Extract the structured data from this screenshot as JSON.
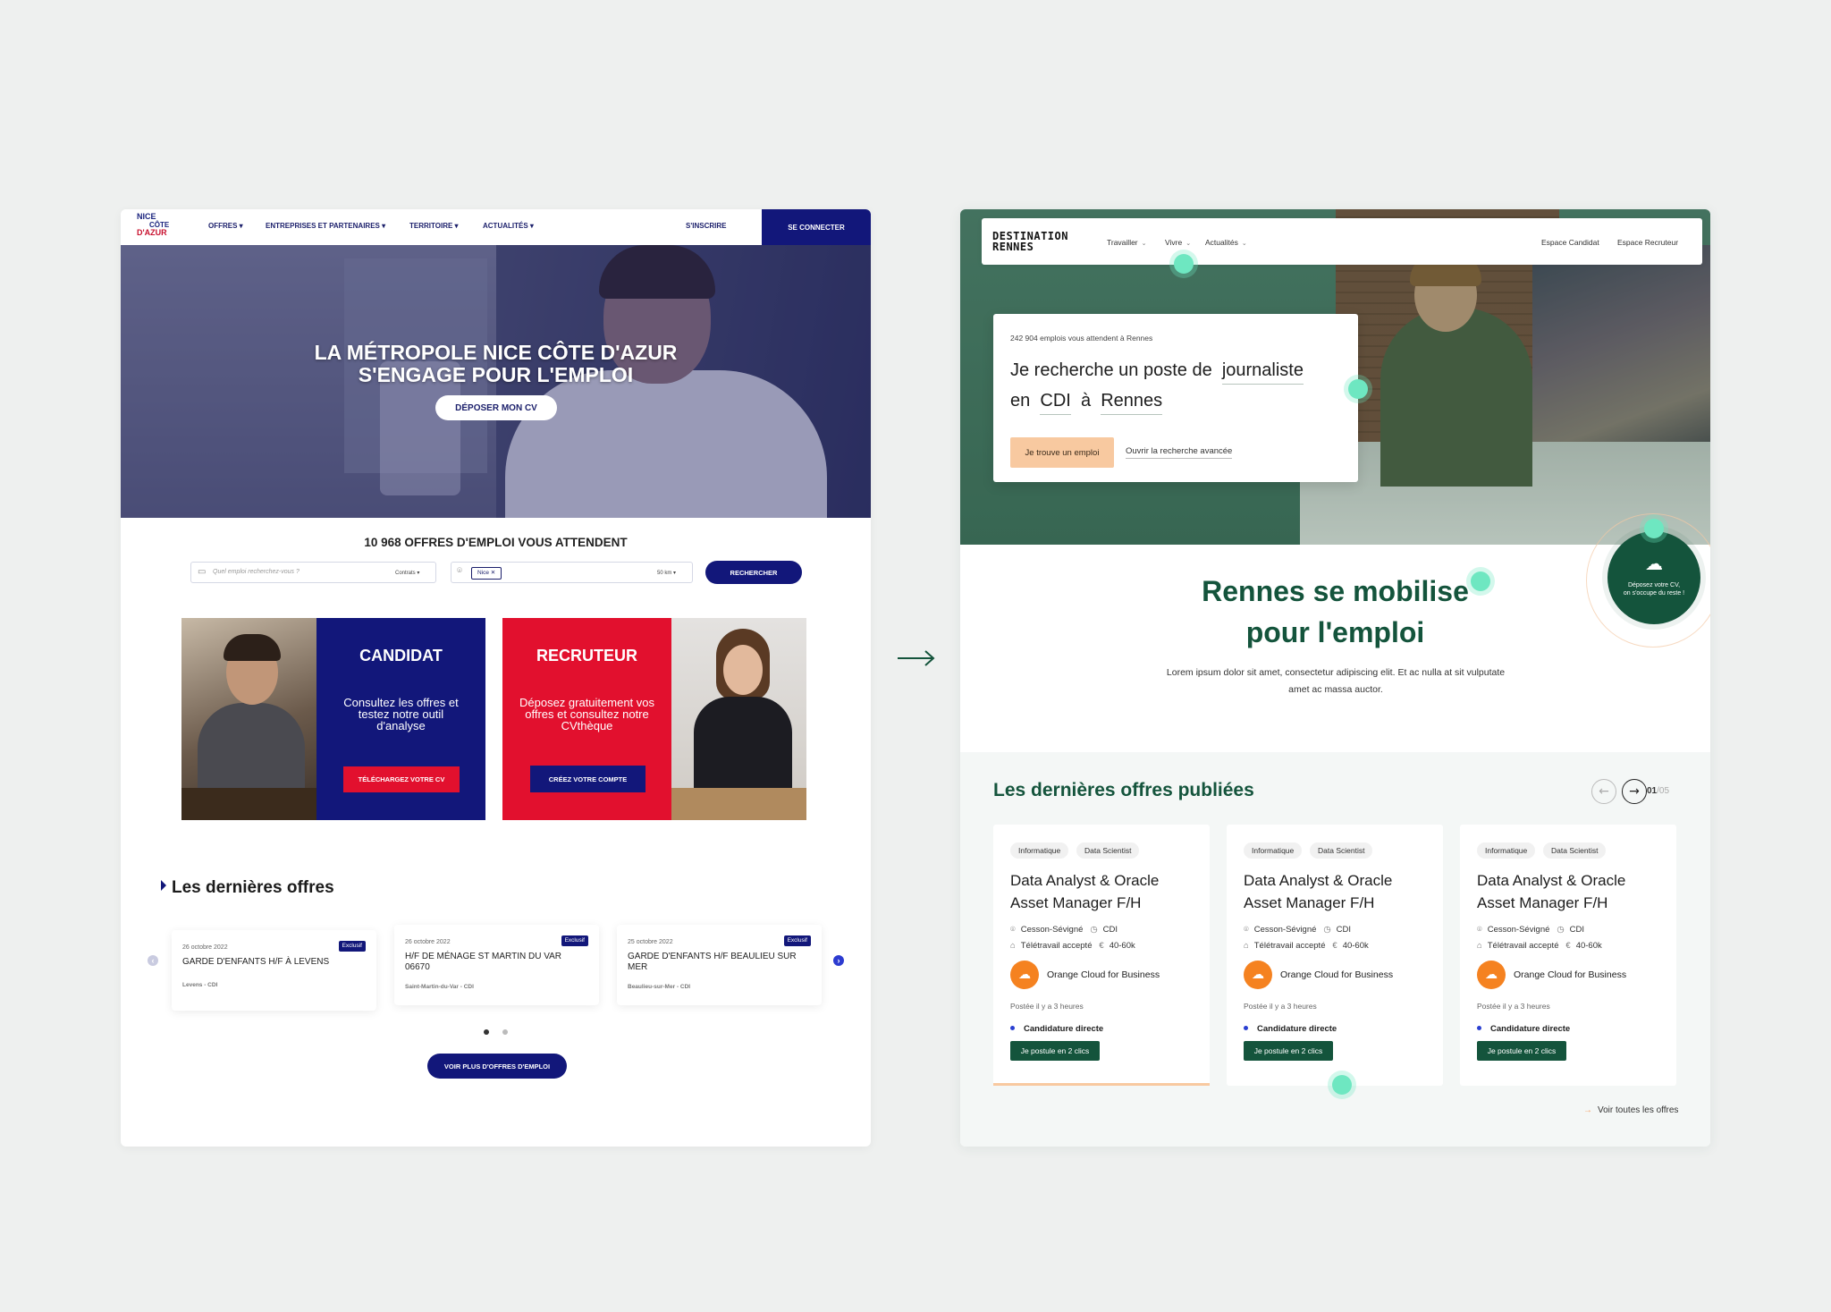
{
  "left": {
    "logo": [
      "NICE",
      "CÔTE",
      "D'AZUR"
    ],
    "nav": {
      "items": [
        "OFFRES ▾",
        "ENTREPRISES ET PARTENAIRES ▾",
        "TERRITOIRE ▾",
        "ACTUALITÉS ▾"
      ],
      "signup": "S'INSCRIRE",
      "login": "SE CONNECTER"
    },
    "hero": {
      "title_line1": "LA MÉTROPOLE NICE CÔTE D'AZUR",
      "title_line2": "S'ENGAGE POUR L'EMPLOI",
      "cta": "DÉPOSER MON CV"
    },
    "count_text": "10 968 OFFRES D'EMPLOI VOUS ATTENDENT",
    "search": {
      "placeholder": "Quel emploi recherchez-vous ?",
      "contract": "Contrats ▾",
      "location_tag": "Nice ✕",
      "radius": "50 km ▾",
      "button": "RECHERCHER"
    },
    "candidat": {
      "title": "CANDIDAT",
      "text": "Consultez les offres et testez notre outil d'analyse",
      "button": "TÉLÉCHARGEZ VOTRE CV"
    },
    "recruteur": {
      "title": "RECRUTEUR",
      "text": "Déposez gratuitement vos offres et consultez notre CVthèque",
      "button": "CRÉEZ VOTRE COMPTE"
    },
    "latest_title": "Les dernières offres",
    "jobs": [
      {
        "date": "26 octobre 2022",
        "badge": "Exclusif",
        "title": "GARDE D'ENFANTS H/F À LEVENS",
        "location": "Levens - CDI"
      },
      {
        "date": "26 octobre 2022",
        "badge": "Exclusif",
        "title": "H/F DE MÉNAGE ST MARTIN DU VAR 06670",
        "location": "Saint-Martin-du-Var - CDI"
      },
      {
        "date": "25 octobre 2022",
        "badge": "Exclusif",
        "title": "GARDE D'ENFANTS H/F BEAULIEU SUR MER",
        "location": "Beaulieu-sur-Mer - CDI"
      }
    ],
    "arrows": {
      "prev": "‹",
      "next": "›"
    },
    "more_button": "VOIR PLUS D'OFFRES D'EMPLOI",
    "colors": {
      "navy": "#12177a",
      "red": "#e2102e"
    }
  },
  "arrow": "→",
  "right": {
    "logo": [
      "DESTINATION",
      "RENNES"
    ],
    "nav": {
      "items": [
        "Travailler",
        "Vivre",
        "Actualités"
      ],
      "candidate": "Espace Candidat",
      "recruiter": "Espace Recruteur"
    },
    "search": {
      "count": "242 904 emplois vous attendent à Rennes",
      "line1_prefix": "Je recherche un poste de",
      "job": "journaliste",
      "line2_prefix": "en",
      "contract": "CDI",
      "line2_mid": "à",
      "city": "Rennes",
      "button": "Je trouve un emploi",
      "advanced": "Ouvrir la recherche avancée"
    },
    "title_line1": "Rennes se mobilise",
    "title_line2": "pour l'emploi",
    "lorem": "Lorem ipsum dolor sit amet, consectetur adipiscing elit. Et ac nulla at sit vulputate amet ac massa auctor.",
    "cv_badge": {
      "icon": "☁",
      "line1": "Déposez votre CV,",
      "line2": "on s'occupe du reste !"
    },
    "offers_title": "Les dernières offres publiées",
    "pager": {
      "prev": "←",
      "next": "→",
      "current": "01",
      "total": "/05"
    },
    "jobs": [
      {
        "tags": [
          "Informatique",
          "Data Scientist"
        ],
        "title": "Data Analyst & Oracle Asset Manager F/H",
        "location": "Cesson-Sévigné",
        "contract": "CDI",
        "remote": "Télétravail accepté",
        "salary": "40-60k",
        "company": "Orange Cloud for Business",
        "posted": "Postée il y a 3 heures",
        "direct": "Candidature directe",
        "apply": "Je postule en 2 clics"
      },
      {
        "tags": [
          "Informatique",
          "Data Scientist"
        ],
        "title": "Data Analyst & Oracle Asset Manager F/H",
        "location": "Cesson-Sévigné",
        "contract": "CDI",
        "remote": "Télétravail accepté",
        "salary": "40-60k",
        "company": "Orange Cloud for Business",
        "posted": "Postée il y a 3 heures",
        "direct": "Candidature directe",
        "apply": "Je postule en 2 clics"
      },
      {
        "tags": [
          "Informatique",
          "Data Scientist"
        ],
        "title": "Data Analyst & Oracle Asset Manager F/H",
        "location": "Cesson-Sévigné",
        "contract": "CDI",
        "remote": "Télétravail accepté",
        "salary": "40-60k",
        "company": "Orange Cloud for Business",
        "posted": "Postée il y a 3 heures",
        "direct": "Candidature directe",
        "apply": "Je postule en 2 clics"
      }
    ],
    "all_offers": "Voir toutes les offres",
    "colors": {
      "green": "#14543c",
      "peach": "#f8c9a0",
      "mint": "#6ee7c1"
    }
  }
}
